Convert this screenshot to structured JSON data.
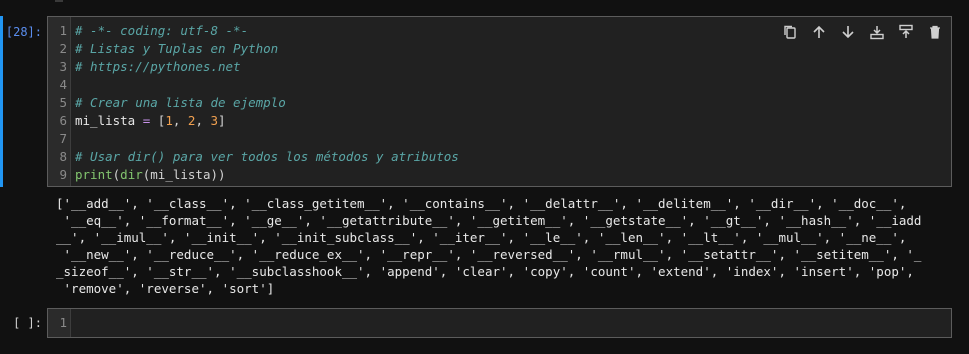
{
  "cell1": {
    "prompt": "[28]:",
    "lines": [
      {
        "n": "1",
        "segments": [
          {
            "t": "# -*- coding: utf-8 -*-",
            "c": "cm"
          }
        ]
      },
      {
        "n": "2",
        "segments": [
          {
            "t": "# Listas y Tuplas en Python",
            "c": "cm"
          }
        ]
      },
      {
        "n": "3",
        "segments": [
          {
            "t": "# https://pythones.net",
            "c": "cm"
          }
        ]
      },
      {
        "n": "4",
        "segments": []
      },
      {
        "n": "5",
        "segments": [
          {
            "t": "# Crear una lista de ejemplo",
            "c": "cm"
          }
        ]
      },
      {
        "n": "6",
        "segments": [
          {
            "t": "mi_lista",
            "c": "var"
          },
          {
            "t": " = ",
            "c": "op"
          },
          {
            "t": "[",
            "c": "pun"
          },
          {
            "t": "1",
            "c": "num"
          },
          {
            "t": ", ",
            "c": "pun"
          },
          {
            "t": "2",
            "c": "num"
          },
          {
            "t": ", ",
            "c": "pun"
          },
          {
            "t": "3",
            "c": "num"
          },
          {
            "t": "]",
            "c": "pun"
          }
        ]
      },
      {
        "n": "7",
        "segments": []
      },
      {
        "n": "8",
        "segments": [
          {
            "t": "# Usar dir() para ver todos los métodos y atributos",
            "c": "cm"
          }
        ]
      },
      {
        "n": "9",
        "segments": [
          {
            "t": "print",
            "c": "fn"
          },
          {
            "t": "(",
            "c": "pun"
          },
          {
            "t": "dir",
            "c": "fn"
          },
          {
            "t": "(mi_lista))",
            "c": "pun"
          }
        ]
      }
    ],
    "output_lines": [
      "['__add__', '__class__', '__class_getitem__', '__contains__', '__delattr__', '__delitem__', '__dir__', '__doc__',",
      " '__eq__', '__format__', '__ge__', '__getattribute__', '__getitem__', '__getstate__', '__gt__', '__hash__', '__iadd",
      "__', '__imul__', '__init__', '__init_subclass__', '__iter__', '__le__', '__len__', '__lt__', '__mul__', '__ne__',",
      " '__new__', '__reduce__', '__reduce_ex__', '__repr__', '__reversed__', '__rmul__', '__setattr__', '__setitem__', '_",
      "_sizeof__', '__str__', '__subclasshook__', 'append', 'clear', 'copy', 'count', 'extend', 'index', 'insert', 'pop',",
      " 'remove', 'reverse', 'sort']"
    ]
  },
  "cell2": {
    "prompt": "[ ]:",
    "line_number": "1"
  },
  "toolbar": {
    "icons": [
      "duplicate-icon",
      "arrow-up-icon",
      "arrow-down-icon",
      "insert-below-icon",
      "insert-above-icon",
      "delete-icon"
    ]
  },
  "colors": {
    "accent": "#2196f3",
    "comment": "#5aa6a6",
    "number": "#f0a050",
    "function": "#82c46e",
    "operator": "#c792ea"
  }
}
